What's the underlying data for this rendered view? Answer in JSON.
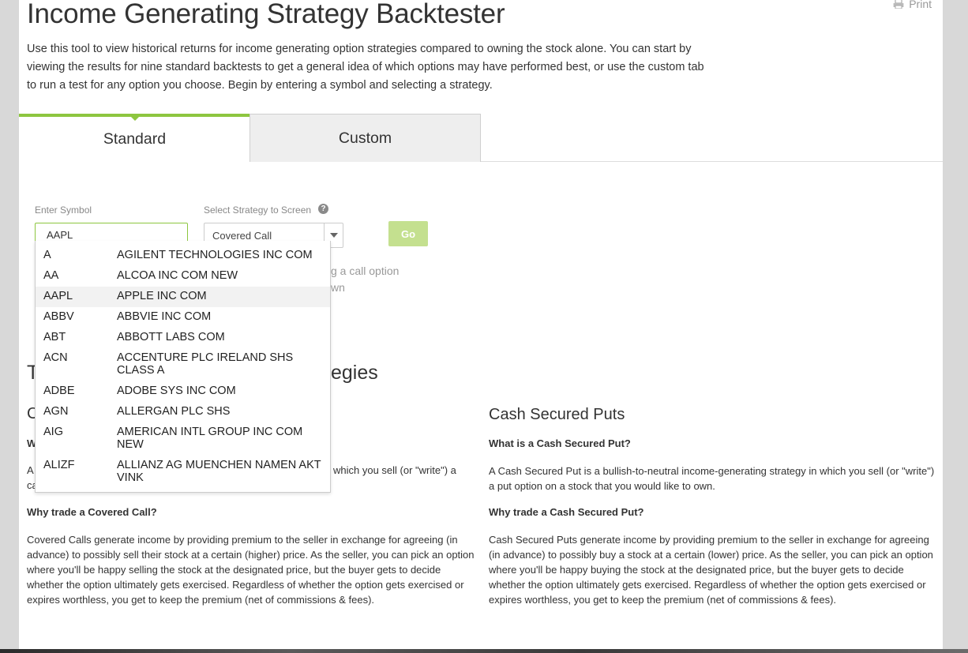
{
  "header": {
    "title": "Income Generating Strategy Backtester",
    "print_label": "Print",
    "intro": "Use this tool to view historical returns for income generating option strategies compared to owning the stock alone. You can start by viewing the results for nine standard backtests to get a general idea of which options may have performed best, or use the custom tab to run a test for any option you choose. Begin by entering a symbol and selecting a strategy."
  },
  "tabs": [
    {
      "label": "Standard",
      "active": true
    },
    {
      "label": "Custom",
      "active": false
    }
  ],
  "form": {
    "symbol_label": "Enter Symbol",
    "symbol_value": "AAPL",
    "strategy_label": "Select Strategy to Screen",
    "strategy_value": "Covered Call",
    "go_label": "Go"
  },
  "behind_text": {
    "line1": "g a call option",
    "line2": "wn",
    "section_title_partial": "egies",
    "letter_t": "T",
    "letter_c": "C",
    "letter_w": "W",
    "letter_a": "A",
    "letter_ca": "ca",
    "cc_def_partial": "which you sell (or \"write\") a"
  },
  "autocomplete": [
    {
      "symbol": "A",
      "name": "AGILENT TECHNOLOGIES INC COM"
    },
    {
      "symbol": "AA",
      "name": "ALCOA INC COM NEW"
    },
    {
      "symbol": "AAPL",
      "name": "APPLE INC COM",
      "highlighted": true
    },
    {
      "symbol": "ABBV",
      "name": "ABBVIE INC COM"
    },
    {
      "symbol": "ABT",
      "name": "ABBOTT LABS COM"
    },
    {
      "symbol": "ACN",
      "name": "ACCENTURE PLC IRELAND SHS CLASS A"
    },
    {
      "symbol": "ADBE",
      "name": "ADOBE SYS INC COM"
    },
    {
      "symbol": "AGN",
      "name": "ALLERGAN PLC SHS"
    },
    {
      "symbol": "AIG",
      "name": "AMERICAN INTL GROUP INC COM NEW"
    },
    {
      "symbol": "ALIZF",
      "name": "ALLIANZ AG MUENCHEN NAMEN AKT VINK"
    }
  ],
  "covered_call": {
    "why_heading": "Why trade a Covered Call?",
    "why_body": "Covered Calls generate income by providing premium to the seller in exchange for agreeing (in advance) to possibly sell their stock at a certain (higher) price. As the seller, you can pick an option where you'll be happy selling the stock at the designated price, but the buyer gets to decide whether the option ultimately gets exercised. Regardless of whether the option gets exercised or expires worthless, you get to keep the premium (net of commissions & fees)."
  },
  "cash_secured_puts": {
    "title": "Cash Secured Puts",
    "what_heading": "What is a Cash Secured Put?",
    "what_body": "A Cash Secured Put is a bullish-to-neutral income-generating strategy in which you sell (or \"write\") a put option on a stock that you would like to own.",
    "why_heading": "Why trade a Cash Secured Put?",
    "why_body": "Cash Secured Puts generate income by providing premium to the seller in exchange for agreeing (in advance) to possibly buy a stock at a certain (lower) price. As the seller, you can pick an option where you'll be happy buying the stock at the designated price, but the buyer gets to decide whether the option ultimately gets exercised. Regardless of whether the option gets exercised or expires worthless, you get to keep the premium (net of commissions & fees)."
  },
  "colors": {
    "accent_green": "#8dc63f",
    "go_disabled": "#c4e08f"
  }
}
